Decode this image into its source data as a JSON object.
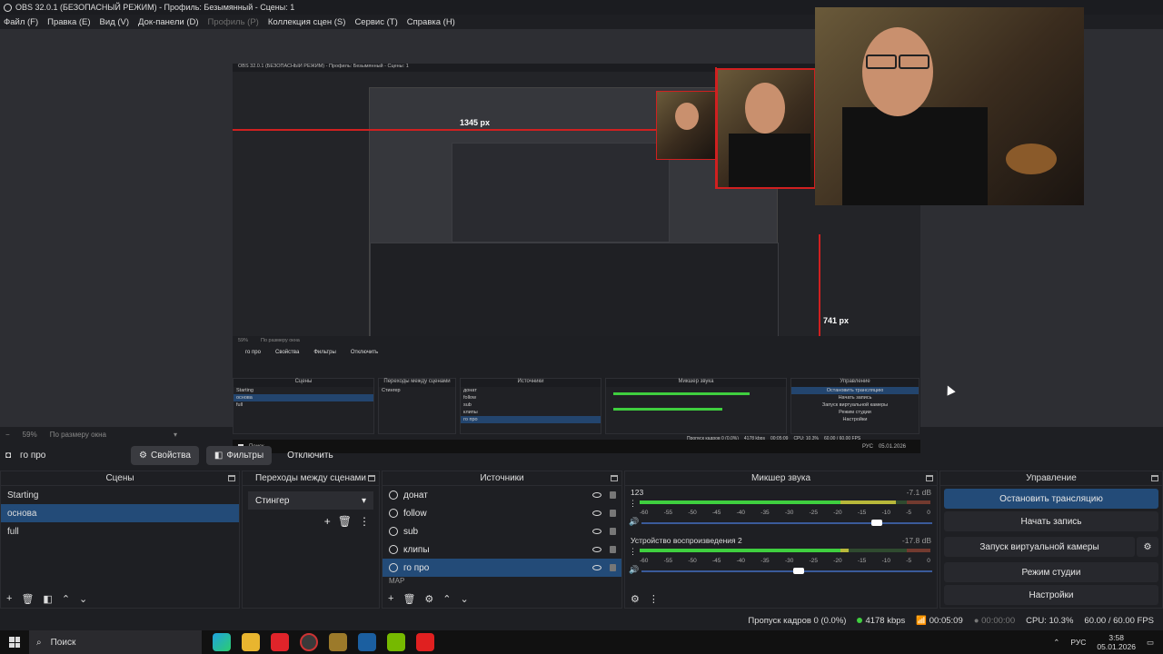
{
  "window": {
    "title": "OBS 32.0.1 (БЕЗОПАСНЫЙ РЕЖИМ) - Профиль: Безымянный - Сцены: 1"
  },
  "menu": {
    "file": "Файл (F)",
    "edit": "Правка (E)",
    "view": "Вид (V)",
    "docks": "Док-панели (D)",
    "profile": "Профиль (P)",
    "scene_collection": "Коллекция сцен (S)",
    "tools": "Сервис (T)",
    "help": "Справка (H)"
  },
  "preview": {
    "measure_width": "1345 px",
    "measure_height": "741 px",
    "nested_title": "OBS 32.0.1 (БЕЗОПАСНЫЙ РЕЖИМ) - Профиль: Безымянный - Сцены: 1",
    "nested_zoom": "59%",
    "nested_zoom_mode": "По размеру окна",
    "nested_source": "го про",
    "nested_btn_props": "Свойства",
    "nested_btn_filters": "Фильтры",
    "nested_btn_disable": "Отключить",
    "nested_docks": [
      "Сцены",
      "Переходы между сценами",
      "Источники",
      "Микшер звука",
      "Управление"
    ],
    "nested_scenes": [
      "Starting",
      "основа",
      "full"
    ],
    "nested_transition": "Стингер",
    "nested_sources": [
      "донат",
      "follow",
      "sub",
      "клипы",
      "го про"
    ],
    "nested_controls": [
      "Остановить трансляцию",
      "Начать запись",
      "Запуск виртуальной камеры",
      "Режим студии",
      "Настройки"
    ],
    "nested_search": "Поиск",
    "nested_lang": "РУС",
    "nested_date": "05.01.2026",
    "nested_status": "Пропуск кадров 0 (0.0%)",
    "nested_kbps": "4178 kbps",
    "nested_time": "00:05:09",
    "nested_cpu": "CPU: 10.3%",
    "nested_fps": "60.00 / 60.00 FPS"
  },
  "zoom": {
    "level": "59%",
    "mode": "По размеру окна"
  },
  "source_bar": {
    "selected": "го про",
    "properties": "Свойства",
    "filters": "Фильтры",
    "disable": "Отключить"
  },
  "docks": {
    "scenes": {
      "title": "Сцены",
      "items": [
        "Starting",
        "основа",
        "full"
      ],
      "selected_index": 1
    },
    "transitions": {
      "title": "Переходы между сценами",
      "current": "Стингер"
    },
    "sources": {
      "title": "Источники",
      "items": [
        "донат",
        "follow",
        "sub",
        "клипы",
        "го про"
      ],
      "partial_item": "МАР",
      "selected_index": 4
    },
    "mixer": {
      "title": "Микшер звука",
      "channels": [
        {
          "name": "123",
          "db": "-7.1 dB",
          "level": 0.88,
          "volume": 0.81
        },
        {
          "name": "Устройство воспроизведения 2",
          "db": "-17.8 dB",
          "level": 0.72,
          "volume": 0.54
        }
      ],
      "ticks": [
        "-60",
        "-55",
        "-50",
        "-45",
        "-40",
        "-35",
        "-30",
        "-25",
        "-20",
        "-15",
        "-10",
        "-5",
        "0"
      ]
    },
    "controls": {
      "title": "Управление",
      "stop_stream": "Остановить трансляцию",
      "start_record": "Начать запись",
      "virtual_cam": "Запуск виртуальной камеры",
      "studio_mode": "Режим студии",
      "settings": "Настройки"
    }
  },
  "status": {
    "dropped": "Пропуск кадров 0 (0.0%)",
    "kbps": "4178 kbps",
    "stream_time": "00:05:09",
    "rec_time": "00:00:00",
    "cpu": "CPU: 10.3%",
    "fps": "60.00 / 60.00 FPS"
  },
  "taskbar": {
    "search": "Поиск",
    "lang": "РУС",
    "time": "3:58",
    "date": "05.01.2026"
  },
  "colors": {
    "accent": "#234b78",
    "meter_green": "#3fcf3f",
    "meter_yellow": "#b8b83a",
    "meter_red": "#a03030",
    "guide_red": "#d02020"
  }
}
